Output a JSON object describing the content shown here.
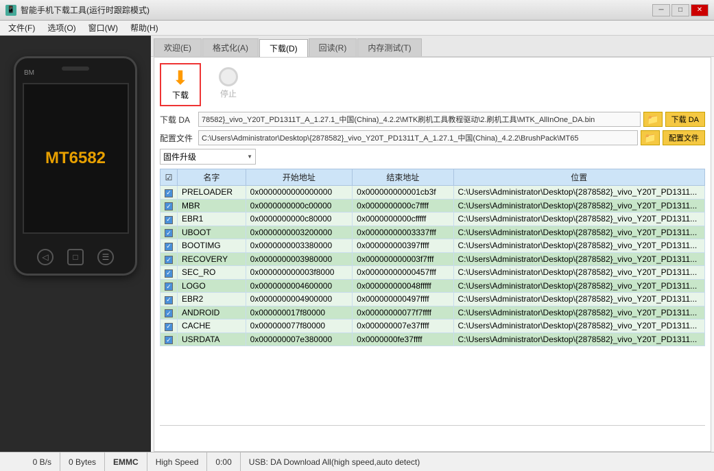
{
  "window": {
    "title": "智能手机下载工具(运行时跟踪模式)",
    "icon": "📱"
  },
  "titlebar": {
    "minimize": "─",
    "restore": "□",
    "close": "✕"
  },
  "menu": {
    "items": [
      {
        "label": "文件(F)"
      },
      {
        "label": "选项(O)"
      },
      {
        "label": "窗口(W)"
      },
      {
        "label": "帮助(H)"
      }
    ]
  },
  "tabs": [
    {
      "label": "欢迎(E)"
    },
    {
      "label": "格式化(A)"
    },
    {
      "label": "下载(D)",
      "active": true
    },
    {
      "label": "回读(R)"
    },
    {
      "label": "内存测试(T)"
    }
  ],
  "toolbar": {
    "download_label": "下载",
    "stop_label": "停止"
  },
  "fields": {
    "da_label": "下载 DA",
    "da_value": "78582}_vivo_Y20T_PD1311T_A_1.27.1_中国(China)_4.2.2\\MTK刷机工具教程驱动\\2.刷机工具\\MTK_AllInOne_DA.bin",
    "da_btn": "下载 DA",
    "config_label": "配置文件",
    "config_value": "C:\\Users\\Administrator\\Desktop\\{2878582}_vivo_Y20T_PD1311T_A_1.27.1_中国(China)_4.2.2\\BrushPack\\MT65",
    "config_btn": "配置文件",
    "mode_value": "固件升级"
  },
  "table": {
    "headers": [
      "☑",
      "名字",
      "开始地址",
      "结束地址",
      "位置"
    ],
    "rows": [
      {
        "checked": true,
        "name": "PRELOADER",
        "start": "0x0000000000000000",
        "end": "0x000000000001cb3f",
        "path": "C:\\Users\\Administrator\\Desktop\\{2878582}_vivo_Y20T_PD1311...",
        "light": true
      },
      {
        "checked": true,
        "name": "MBR",
        "start": "0x0000000000c00000",
        "end": "0x0000000000c7ffff",
        "path": "C:\\Users\\Administrator\\Desktop\\{2878582}_vivo_Y20T_PD1311...",
        "light": false
      },
      {
        "checked": true,
        "name": "EBR1",
        "start": "0x0000000000c80000",
        "end": "0x0000000000cfffff",
        "path": "C:\\Users\\Administrator\\Desktop\\{2878582}_vivo_Y20T_PD1311...",
        "light": true
      },
      {
        "checked": true,
        "name": "UBOOT",
        "start": "0x0000000003200000",
        "end": "0x00000000003337fff",
        "path": "C:\\Users\\Administrator\\Desktop\\{2878582}_vivo_Y20T_PD1311...",
        "light": false
      },
      {
        "checked": true,
        "name": "BOOTIMG",
        "start": "0x0000000003380000",
        "end": "0x000000000397ffff",
        "path": "C:\\Users\\Administrator\\Desktop\\{2878582}_vivo_Y20T_PD1311...",
        "light": true
      },
      {
        "checked": true,
        "name": "RECOVERY",
        "start": "0x0000000003980000",
        "end": "0x000000000003f7fff",
        "path": "C:\\Users\\Administrator\\Desktop\\{2878582}_vivo_Y20T_PD1311...",
        "light": false
      },
      {
        "checked": true,
        "name": "SEC_RO",
        "start": "0x000000000003f8000",
        "end": "0x00000000000457fff",
        "path": "C:\\Users\\Administrator\\Desktop\\{2878582}_vivo_Y20T_PD1311...",
        "light": true
      },
      {
        "checked": true,
        "name": "LOGO",
        "start": "0x0000000004600000",
        "end": "0x000000000048fffff",
        "path": "C:\\Users\\Administrator\\Desktop\\{2878582}_vivo_Y20T_PD1311...",
        "light": false
      },
      {
        "checked": true,
        "name": "EBR2",
        "start": "0x0000000004900000",
        "end": "0x000000000497ffff",
        "path": "C:\\Users\\Administrator\\Desktop\\{2878582}_vivo_Y20T_PD1311...",
        "light": true
      },
      {
        "checked": true,
        "name": "ANDROID",
        "start": "0x000000017f80000",
        "end": "0x00000000077f7ffff",
        "path": "C:\\Users\\Administrator\\Desktop\\{2878582}_vivo_Y20T_PD1311...",
        "light": false
      },
      {
        "checked": true,
        "name": "CACHE",
        "start": "0x000000077f80000",
        "end": "0x000000007e37ffff",
        "path": "C:\\Users\\Administrator\\Desktop\\{2878582}_vivo_Y20T_PD1311...",
        "light": true
      },
      {
        "checked": true,
        "name": "USRDATA",
        "start": "0x000000007e380000",
        "end": "0x0000000fe37ffff",
        "path": "C:\\Users\\Administrator\\Desktop\\{2878582}_vivo_Y20T_PD1311...",
        "light": false
      }
    ]
  },
  "statusbar": {
    "speed": "0 B/s",
    "bytes": "0 Bytes",
    "storage": "EMMC",
    "mode": "High Speed",
    "time": "0:00",
    "usb": "USB: DA Download All(high speed,auto detect)"
  },
  "phone": {
    "brand": "BM",
    "chip": "MT6582"
  }
}
